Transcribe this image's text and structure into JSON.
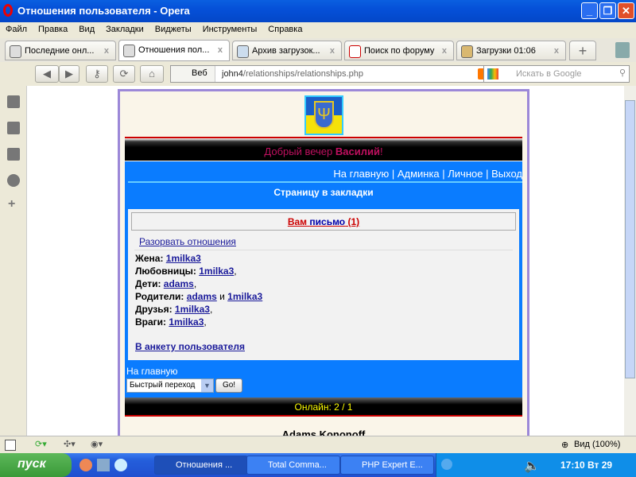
{
  "window": {
    "title": "Отношения пользователя - Opera"
  },
  "menu": [
    "Файл",
    "Правка",
    "Вид",
    "Закладки",
    "Виджеты",
    "Инструменты",
    "Справка"
  ],
  "tabs": [
    {
      "label": "Последние онл...",
      "close": "x"
    },
    {
      "label": "Отношения пол...",
      "close": "x"
    },
    {
      "label": "Архив загрузок...",
      "close": "x"
    },
    {
      "label": "Поиск по форуму",
      "close": "x"
    },
    {
      "label": "Загрузки 01:06",
      "close": "x"
    }
  ],
  "address": {
    "web_label": "Веб",
    "url_host": "john4",
    "url_path": "/relationships/relationships.php",
    "search_placeholder": "Искать в Google"
  },
  "page": {
    "greeting_prefix": "Добрый вечер ",
    "greeting_name": "Василий",
    "greeting_suffix": "!",
    "nav": [
      "На главную",
      " | ",
      "Админка",
      " | ",
      "Личное",
      " | ",
      "Выход"
    ],
    "bookmark": "Страницу в закладки",
    "mail_a": "Вам",
    "mail_b": "письмо",
    "mail_c": "(1)",
    "break_link": "Разорвать отношения",
    "relations": {
      "wife_label": "Жена: ",
      "wife": "1milka3",
      "lovers_label": "Любовницы: ",
      "lovers": "1milka3",
      "children_label": "Дети: ",
      "children": "adams",
      "parents_label": "Родители: ",
      "parent1": "adams",
      "and": " и ",
      "parent2": "1milka3",
      "friends_label": "Друзья: ",
      "friends": "1milka3",
      "enemies_label": "Враги: ",
      "enemies": "1milka3",
      "comma": ","
    },
    "profile_link": "В анкету пользователя",
    "home_link": "На главную",
    "quick_select": "Быстрый переход",
    "go": "Go!",
    "online": "Онлайн: 2 / 1",
    "author": "Adams Kononoff"
  },
  "statusbar": {
    "zoom": "Вид (100%)"
  },
  "taskbar": {
    "start": "пуск",
    "items": [
      "Отношения ...",
      "Total Comma...",
      "PHP Expert E..."
    ],
    "clock": "17:10 Вт 29"
  }
}
